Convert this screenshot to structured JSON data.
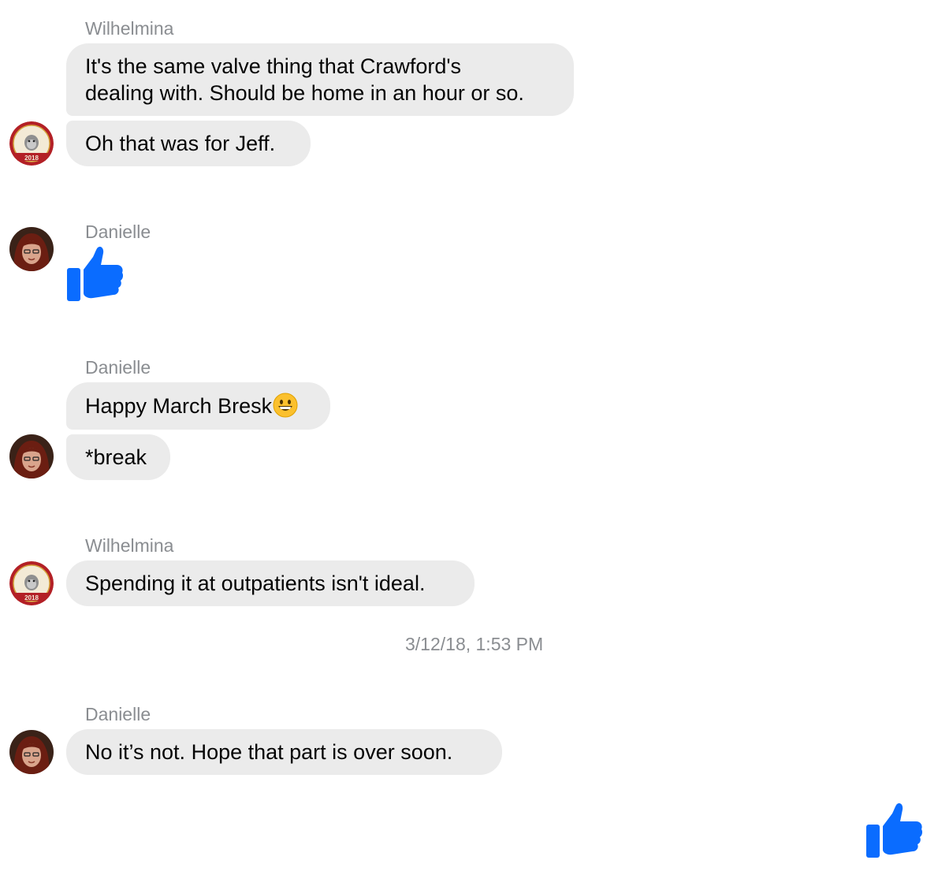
{
  "messages": {
    "g1": {
      "sender": "Wilhelmina",
      "line1": "It's the same valve thing that Crawford's",
      "line2": "dealing with. Should be home in an hour or so.",
      "line3": "Oh that was for Jeff."
    },
    "g2": {
      "sender": "Danielle",
      "reaction": "thumbs-up-icon"
    },
    "g3": {
      "sender": "Danielle",
      "line1": "Happy March Bresk",
      "emoji": "grinning-face-icon",
      "line2": "*break"
    },
    "g4": {
      "sender": "Wilhelmina",
      "line1": "Spending it at outpatients isn't ideal."
    },
    "timestamp": "3/12/18, 1:53 PM",
    "g5": {
      "sender": "Danielle",
      "line1": "No it’s not. Hope that part is over soon."
    }
  },
  "avatars": {
    "wilhelmina": {
      "badge_text": "2018",
      "rim_color": "#b32026",
      "inner_color": "#f3ead6"
    },
    "danielle": {
      "hair_color": "#6b1e12",
      "skin_color": "#d9a48c"
    }
  },
  "colors": {
    "bubble": "#ebebeb",
    "meta_text": "#8a8d91",
    "like_blue": "#0a6cff"
  }
}
